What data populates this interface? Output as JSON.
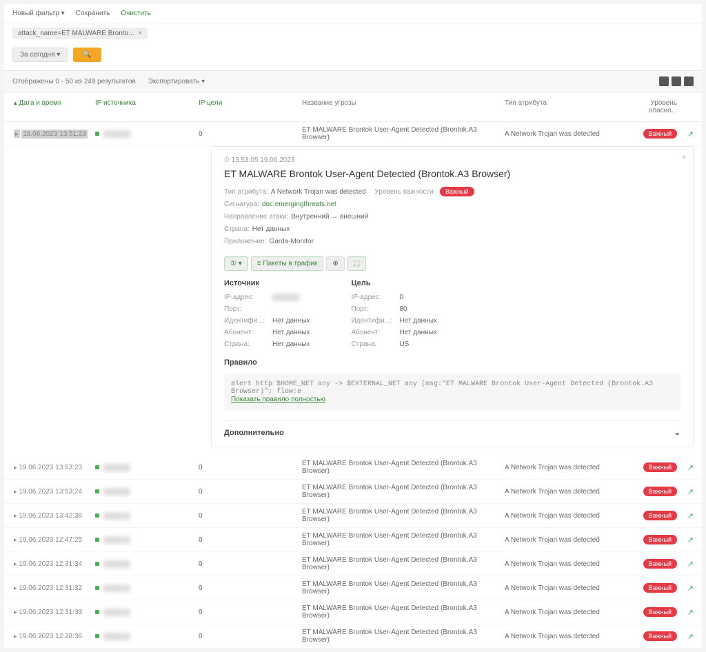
{
  "topbar": {
    "new_filter": "Новый фильтр ▾",
    "save": "Сохранить",
    "clear": "Очистить"
  },
  "filter_tag": {
    "label": "attack_name=ET MALWARE Bronto...",
    "close": "×"
  },
  "period": "За сегодня ▾",
  "search_icon": "🔍",
  "results_summary": "Отображены 0 - 50 из 249 результатов",
  "export_label": "Экспортировать ▾",
  "headers": {
    "date": "Дата и время",
    "src": "IP источника",
    "tgt": "IP цели",
    "threat": "Название угрозы",
    "class": "Тип атрибута",
    "level": "Уровень опасно..."
  },
  "rows": [
    {
      "date": "19.06.2023 13:51:23",
      "tgt": "0",
      "threat": "ET MALWARE Brontok User-Agent Detected (Brontok.A3 Browser)",
      "cls": "A Network Trojan was detected",
      "level": "Важный",
      "selected": true
    },
    {
      "date": "19.06.2023 13:53:23",
      "tgt": "0",
      "threat": "ET MALWARE Brontok User-Agent Detected (Brontok.A3 Browser)",
      "cls": "A Network Trojan was detected",
      "level": "Важный"
    },
    {
      "date": "19.06.2023 13:53:24",
      "tgt": "0",
      "threat": "ET MALWARE Brontok User-Agent Detected (Brontok.A3 Browser)",
      "cls": "A Network Trojan was detected",
      "level": "Важный"
    },
    {
      "date": "19.06.2023 13:42:38",
      "tgt": "0",
      "threat": "ET MALWARE Brontok User-Agent Detected (Brontok.A3 Browser)",
      "cls": "A Network Trojan was detected",
      "level": "Важный"
    },
    {
      "date": "19.06.2023 12:47:25",
      "tgt": "0",
      "threat": "ET MALWARE Brontok User-Agent Detected (Brontok.A3 Browser)",
      "cls": "A Network Trojan was detected",
      "level": "Важный"
    },
    {
      "date": "19.06.2023 12:31:34",
      "tgt": "0",
      "threat": "ET MALWARE Brontok User-Agent Detected (Brontok.A3 Browser)",
      "cls": "A Network Trojan was detected",
      "level": "Важный"
    },
    {
      "date": "19.06.2023 12:31:32",
      "tgt": "0",
      "threat": "ET MALWARE Brontok User-Agent Detected (Brontok.A3 Browser)",
      "cls": "A Network Trojan was detected",
      "level": "Важный"
    },
    {
      "date": "19.06.2023 12:31:33",
      "tgt": "0",
      "threat": "ET MALWARE Brontok User-Agent Detected (Brontok.A3 Browser)",
      "cls": "A Network Trojan was detected",
      "level": "Важный"
    },
    {
      "date": "19.06.2023 12:28:36",
      "tgt": "0",
      "threat": "ET MALWARE Brontok User-Agent Detected (Brontok.A3 Browser)",
      "cls": "A Network Trojan was detected",
      "level": "Важный"
    }
  ],
  "detail": {
    "time_prefix": "⏱ 13:53:05   19.06.2023",
    "title": "ET MALWARE Brontok User-Agent Detected (Brontok.A3 Browser)",
    "level_lbl": "Уровень важности:",
    "level_val": "Важный",
    "type_lbl": "Тип атрибута:",
    "type_val": "A Network Trojan was detected",
    "sig_lbl": "Сигнатура:",
    "sig_val": "doc.emergingthreats.net",
    "dir_lbl": "Направление атаки:",
    "dir_val": "Внутренний → внешний",
    "country_lbl": "Страна:",
    "country_val": "Нет данных",
    "app_lbl": "Приложение:",
    "app_val": "Garda-Monitor",
    "actions": {
      "b1": "① ▾",
      "b2": "≡ Пакеты в трафик",
      "b3": "⊕",
      "b4": "⬚"
    },
    "src_h": "Источник",
    "tgt_h": "Цель",
    "kv": {
      "ip": "IP-адрес:",
      "port": "Порт:",
      "vlan": "Идентифи...:",
      "asn": "Абонент:",
      "country2": "Страна:",
      "src_ip": "████",
      "src_port": "",
      "src_vlan": "Нет данных",
      "src_asn": "Нет данных",
      "src_country": "Нет данных",
      "tgt_ip": "0",
      "tgt_port": "80",
      "tgt_vlan": "Нет данных",
      "tgt_asn": "Нет данных",
      "tgt_country": "US"
    },
    "rule_h": "Правило",
    "rule_text": "alert http $HOME_NET any -> $EXTERNAL_NET any (msg:\"ET MALWARE Brontok User-Agent Detected (Brontok.A3 Browser)\"; flow:e",
    "rule_link": "Показать правило полностью",
    "additional": "Дополнительно",
    "chevron": "⌄"
  }
}
